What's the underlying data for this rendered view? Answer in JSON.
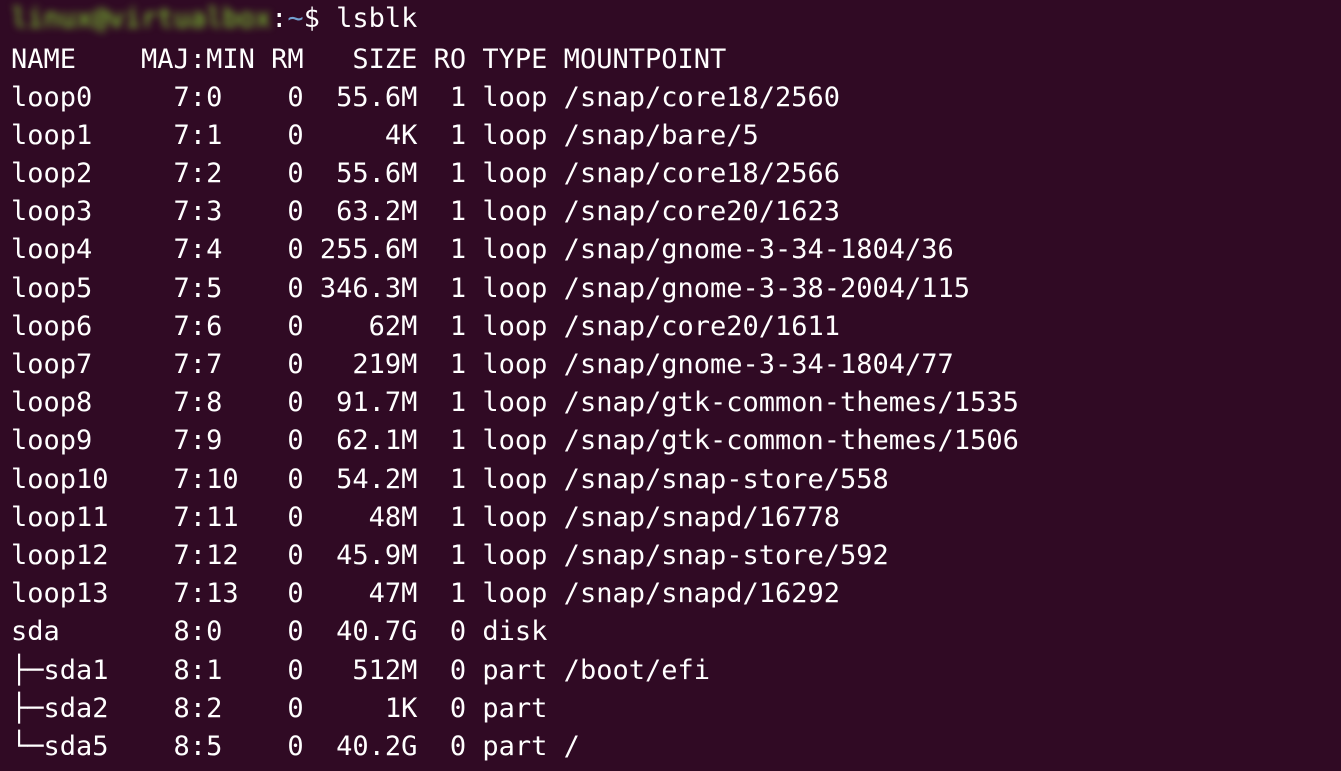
{
  "colors": {
    "background": "#300a24",
    "foreground": "#ffffff",
    "prompt_user": "#8ae234",
    "prompt_path": "#729fcf"
  },
  "prompt": {
    "user_host": "linux@virtualbox",
    "separator": ":",
    "path": "~",
    "symbol": "$ ",
    "command": "lsblk"
  },
  "output": {
    "header": "NAME    MAJ:MIN RM   SIZE RO TYPE MOUNTPOINT",
    "rows": [
      "loop0     7:0    0  55.6M  1 loop /snap/core18/2560",
      "loop1     7:1    0     4K  1 loop /snap/bare/5",
      "loop2     7:2    0  55.6M  1 loop /snap/core18/2566",
      "loop3     7:3    0  63.2M  1 loop /snap/core20/1623",
      "loop4     7:4    0 255.6M  1 loop /snap/gnome-3-34-1804/36",
      "loop5     7:5    0 346.3M  1 loop /snap/gnome-3-38-2004/115",
      "loop6     7:6    0    62M  1 loop /snap/core20/1611",
      "loop7     7:7    0   219M  1 loop /snap/gnome-3-34-1804/77",
      "loop8     7:8    0  91.7M  1 loop /snap/gtk-common-themes/1535",
      "loop9     7:9    0  62.1M  1 loop /snap/gtk-common-themes/1506",
      "loop10    7:10   0  54.2M  1 loop /snap/snap-store/558",
      "loop11    7:11   0    48M  1 loop /snap/snapd/16778",
      "loop12    7:12   0  45.9M  1 loop /snap/snap-store/592",
      "loop13    7:13   0    47M  1 loop /snap/snapd/16292",
      "sda       8:0    0  40.7G  0 disk",
      "├─sda1    8:1    0   512M  0 part /boot/efi",
      "├─sda2    8:2    0     1K  0 part",
      "└─sda5    8:5    0  40.2G  0 part /"
    ]
  }
}
